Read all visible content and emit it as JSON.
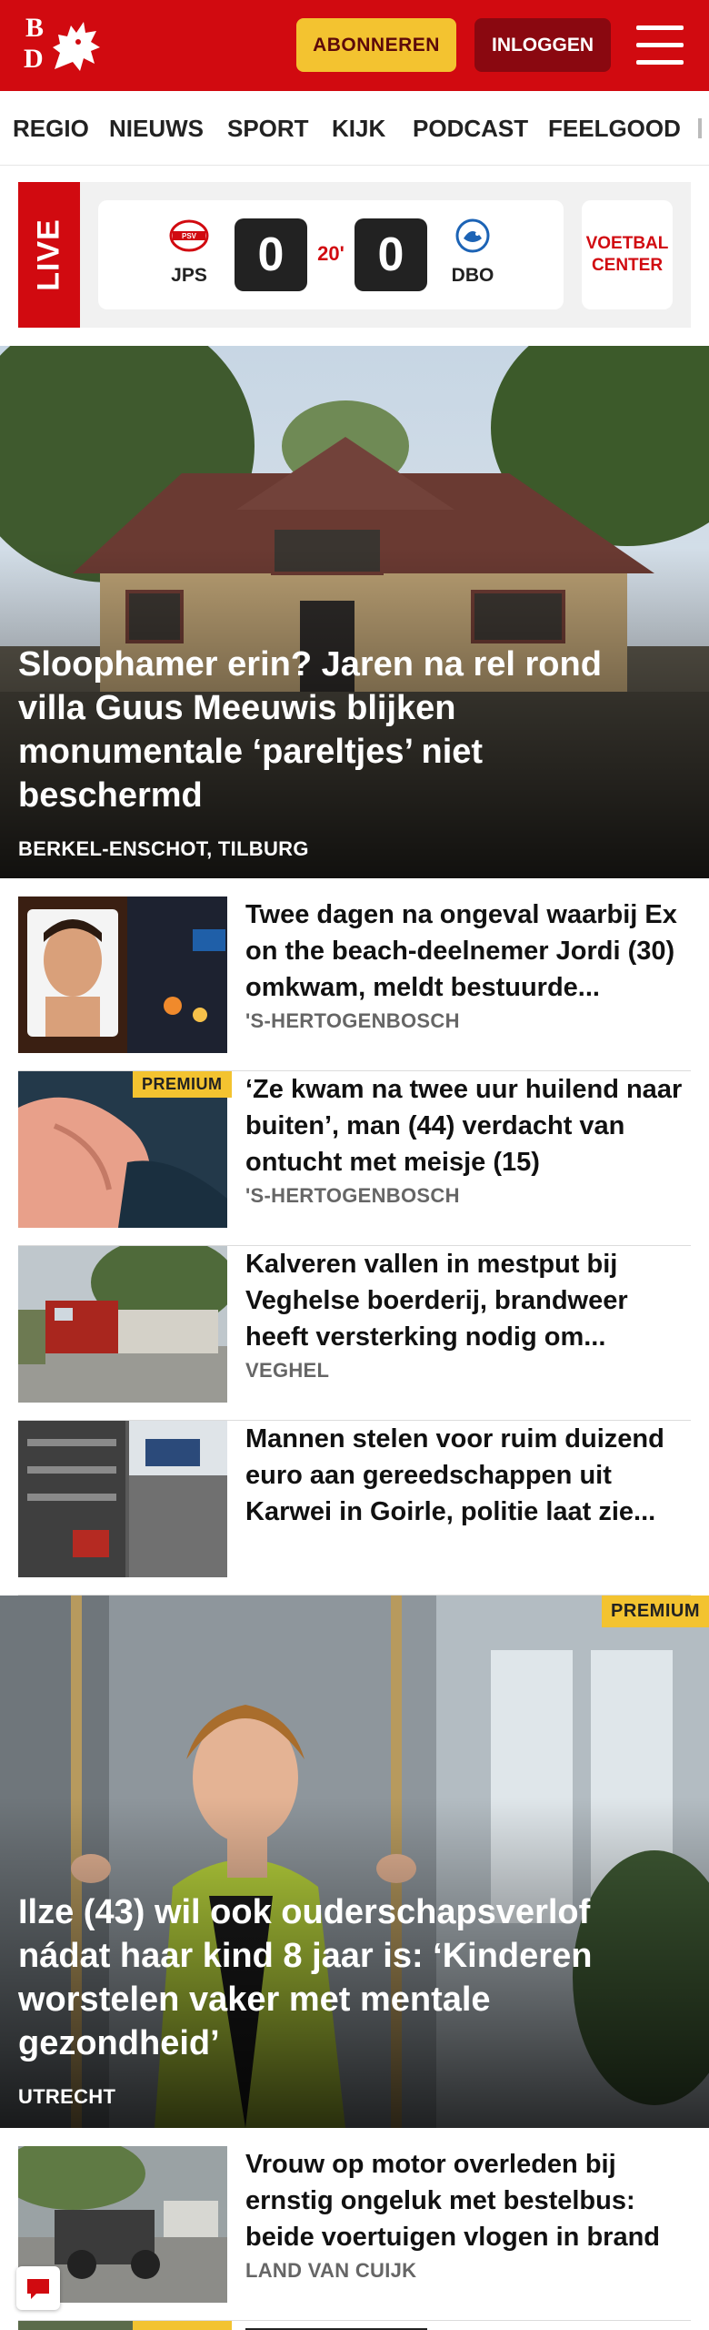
{
  "header": {
    "logo_letters": [
      "B",
      "D"
    ],
    "subscribe_label": "ABONNEREN",
    "login_label": "INLOGGEN",
    "menu_icon": "hamburger-icon",
    "brand_color": "#d10a10",
    "accent_color": "#f3c330"
  },
  "nav": {
    "items": [
      "REGIO",
      "NIEUWS",
      "SPORT",
      "KIJK",
      "PODCAST",
      "FEELGOOD"
    ]
  },
  "live": {
    "tab_label": "LIVE",
    "home_team": "JPS",
    "home_score": "0",
    "minute": "20'",
    "away_score": "0",
    "away_team": "DBO",
    "voetbal_center_line1": "VOETBAL",
    "voetbal_center_line2": "CENTER"
  },
  "hero1": {
    "title": "Sloophamer erin? Jaren na rel rond villa Guus Meeuwis blijken monumentale ‘pareltjes’ niet beschermd",
    "location": "BERKEL-ENSCHOT, TILBURG"
  },
  "articles": [
    {
      "title": "Twee dagen na ongeval waarbij Ex on the beach-deelnemer Jordi (30) omkwam, meldt bestuurde...",
      "location": "'S-HERTOGENBOSCH",
      "premium": ""
    },
    {
      "title": "‘Ze kwam na twee uur huilend naar buiten’, man (44) verdacht van ontucht met meisje (15)",
      "location": "'S-HERTOGENBOSCH",
      "premium": "PREMIUM"
    },
    {
      "title": "Kalveren vallen in mestput bij Veghelse boerderij, brandweer heeft versterking nodig om...",
      "location": "VEGHEL",
      "premium": ""
    },
    {
      "title": "Mannen stelen voor ruim duizend euro aan gereedschappen uit Karwei in Goirle, politie laat zie...",
      "location": "",
      "premium": ""
    }
  ],
  "hero2": {
    "premium": "PREMIUM",
    "title": "Ilze (43) wil ook ouderschapsverlof nádat haar kind 8 jaar is: ‘Kinderen worstelen vaker met mentale gezondheid’",
    "location": "UTRECHT"
  },
  "articles2": [
    {
      "title": "Vrouw op motor overleden bij ernstig ongeluk met bestelbus: beide voertuigen vlogen in brand",
      "location": "LAND VAN CUIJK",
      "premium": ""
    },
    {
      "title": "",
      "location": "",
      "premium": "PREMIUM"
    }
  ]
}
